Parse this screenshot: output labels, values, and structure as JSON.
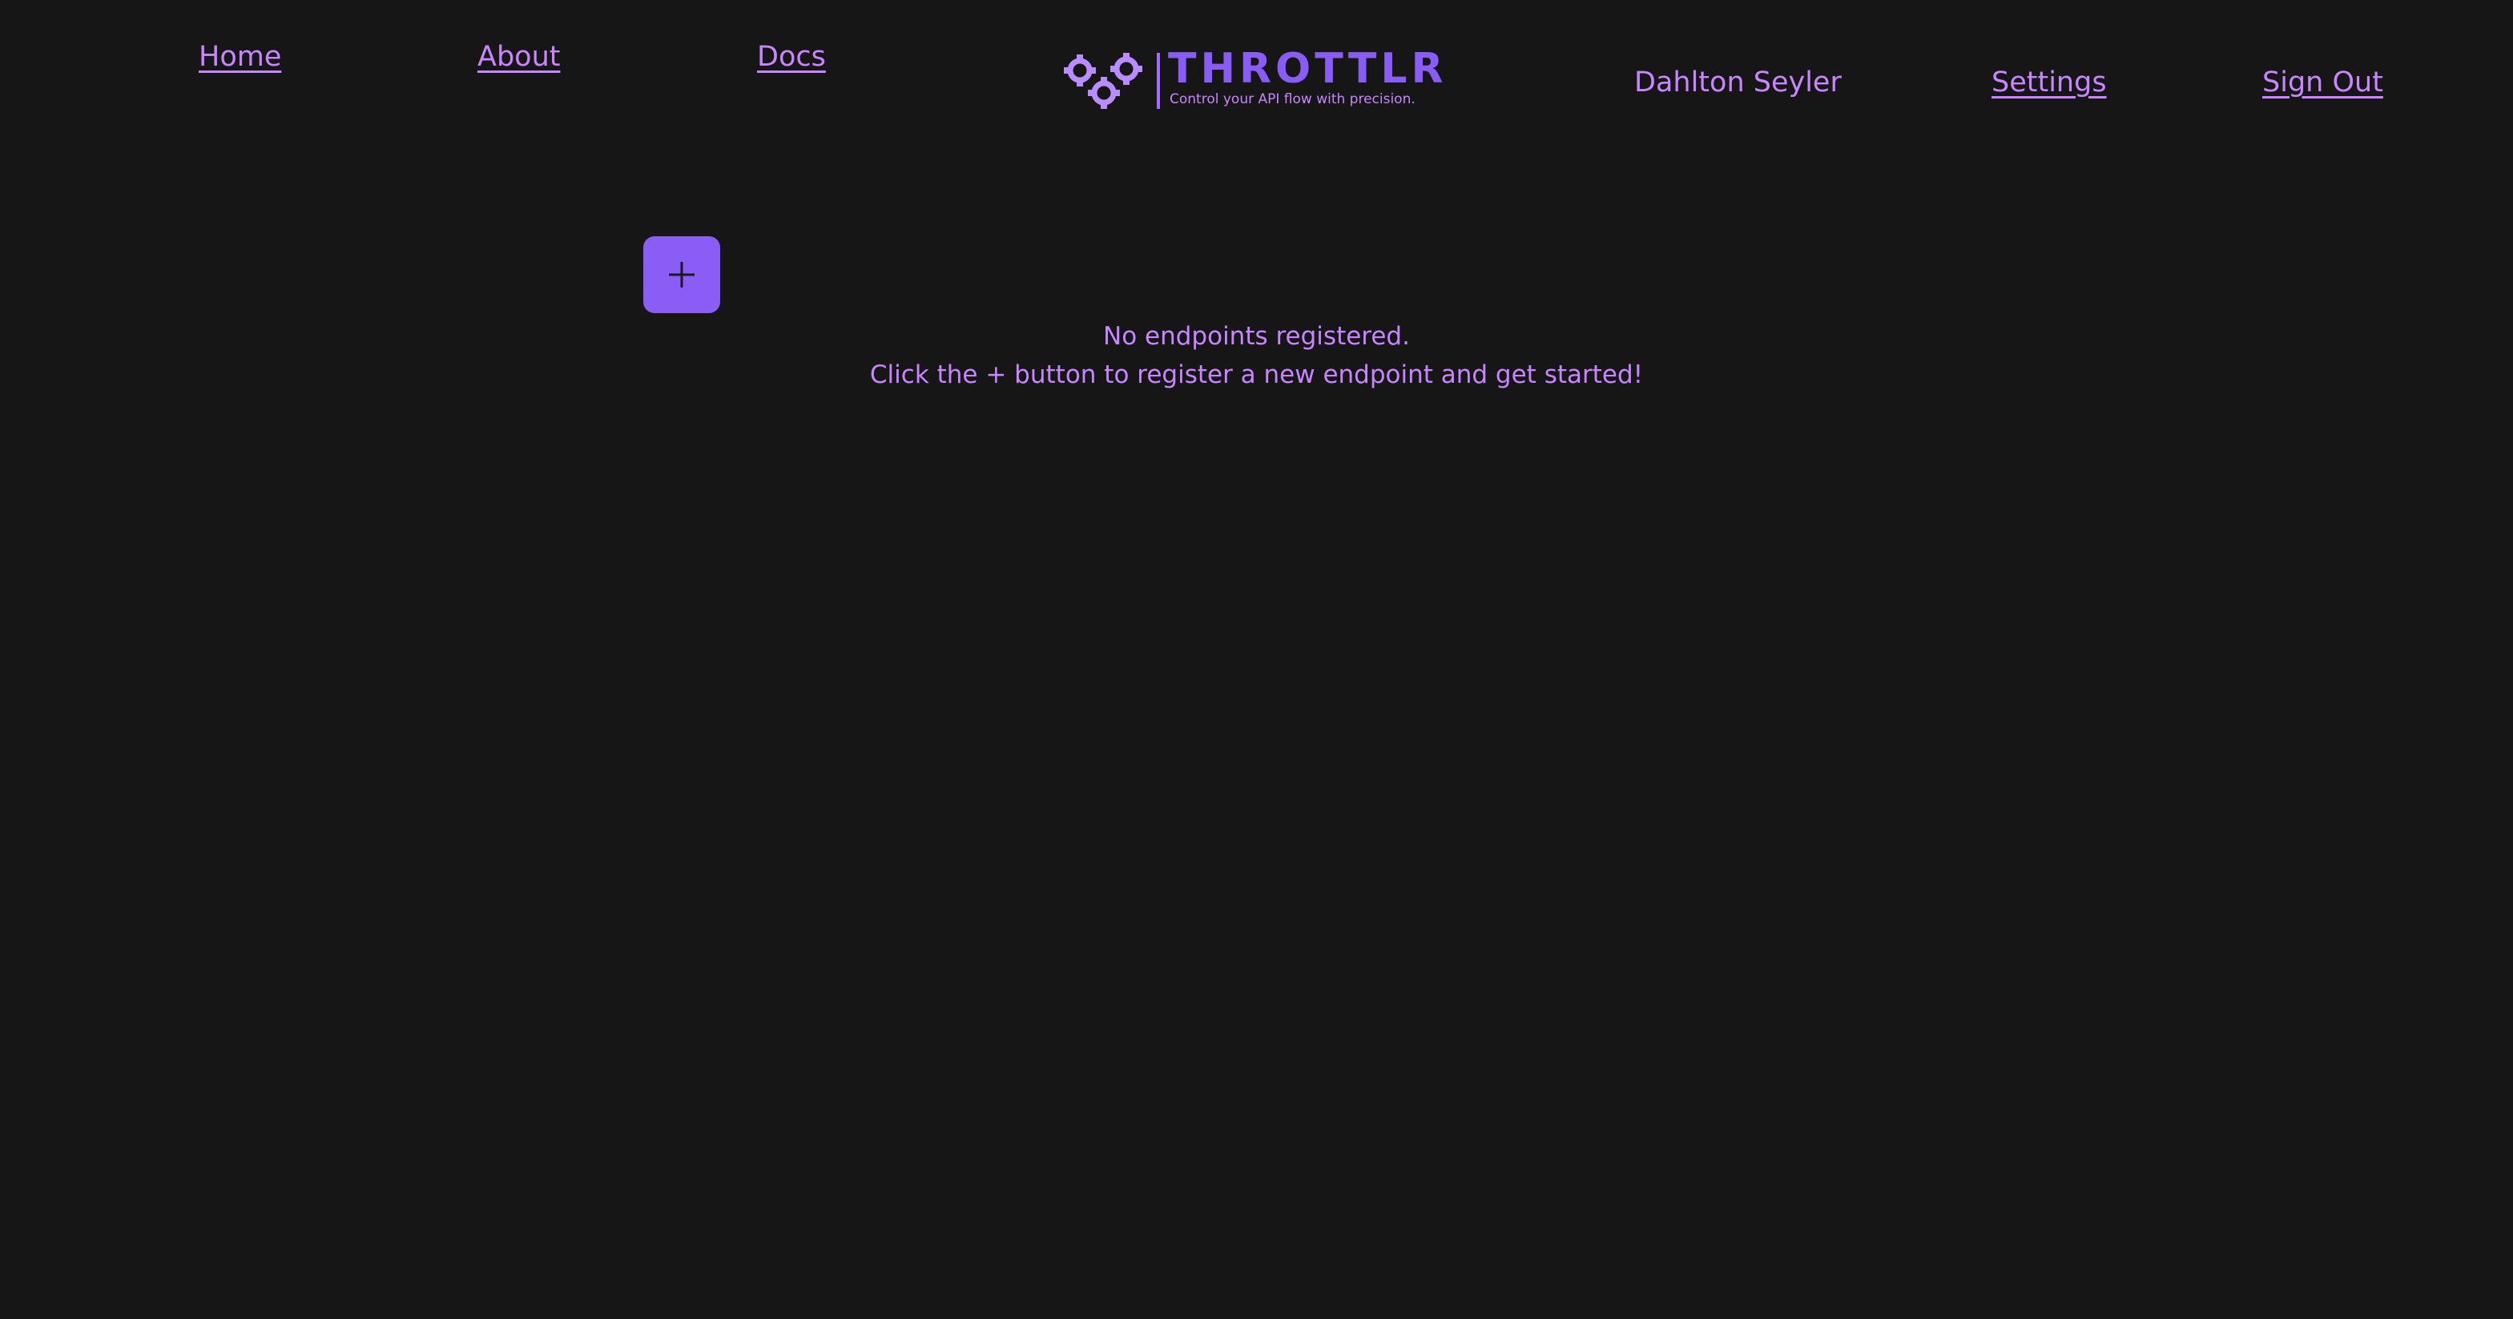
{
  "nav": {
    "left": [
      {
        "label": "Home"
      },
      {
        "label": "About"
      },
      {
        "label": "Docs"
      }
    ],
    "user_name": "Dahlton Seyler",
    "right": [
      {
        "label": "Settings"
      },
      {
        "label": "Sign Out"
      }
    ]
  },
  "logo": {
    "wordmark": "THROTTLR",
    "tagline": "Control your API flow with precision.",
    "icon": "gears-icon"
  },
  "add_button": {
    "icon": "plus-icon"
  },
  "empty_state": {
    "line1": "No endpoints registered.",
    "line2": "Click the + button to register a new endpoint and get started!"
  },
  "colors": {
    "background": "#161616",
    "accent": "#8b5cf6",
    "text": "#c984ff"
  }
}
